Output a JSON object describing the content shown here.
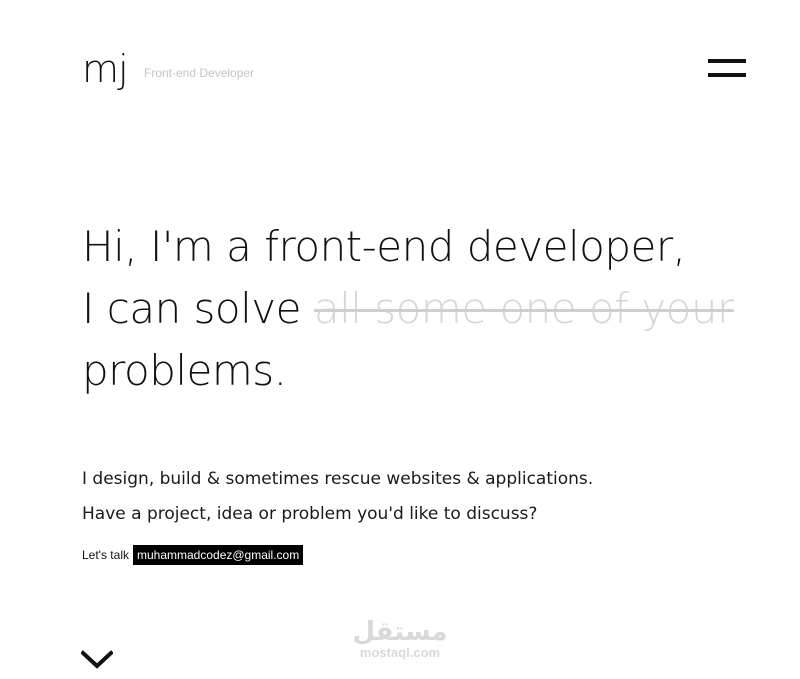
{
  "header": {
    "logo": "mj",
    "tagline": "Front-end Developer",
    "menu_icon": "hamburger-menu-icon"
  },
  "hero": {
    "line1": "Hi, I'm a front-end developer,",
    "line2_prefix": "I can solve",
    "line2_struck": "all some one of your",
    "line3": "problems."
  },
  "intro": {
    "line1": "I design, build & sometimes rescue websites & applications.",
    "line2": "Have a project, idea or problem you'd like to discuss?"
  },
  "contact": {
    "label": "Let's talk",
    "email": "muhammadcodez@gmail.com"
  },
  "watermark": {
    "arabic": "مستقل",
    "latin": "mostaql.com"
  },
  "scroll": {
    "icon": "chevron-down-icon"
  },
  "colors": {
    "background": "#ffffff",
    "text": "#111111",
    "muted": "#c4c4c4",
    "struck": "#d6d6d6",
    "email_bg": "#000000",
    "email_text": "#ffffff"
  }
}
